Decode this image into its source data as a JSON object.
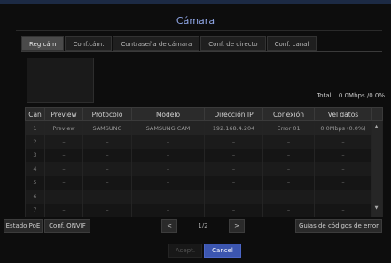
{
  "window": {
    "title": "Cámara"
  },
  "tabs": [
    {
      "label": "Reg cám",
      "active": true
    },
    {
      "label": "Conf.cám."
    },
    {
      "label": "Contraseña de cámara"
    },
    {
      "label": "Conf. de directo"
    },
    {
      "label": "Conf. canal"
    }
  ],
  "total": {
    "label": "Total:",
    "value": "0.0Mbps /0.0%"
  },
  "table": {
    "headers": [
      "Can",
      "Preview",
      "Protocolo",
      "Modelo",
      "Dirección IP",
      "Conexión",
      "Vel datos"
    ],
    "rows": [
      [
        "1",
        "Preview",
        "SAMSUNG",
        "SAMSUNG CAM",
        "192.168.4.204",
        "Error 01",
        "0.0Mbps (0.0%)"
      ],
      [
        "2",
        "–",
        "–",
        "–",
        "–",
        "–",
        "–"
      ],
      [
        "3",
        "–",
        "–",
        "–",
        "–",
        "–",
        "–"
      ],
      [
        "4",
        "–",
        "–",
        "–",
        "–",
        "–",
        "–"
      ],
      [
        "5",
        "–",
        "–",
        "–",
        "–",
        "–",
        "–"
      ],
      [
        "6",
        "–",
        "–",
        "–",
        "–",
        "–",
        "–"
      ],
      [
        "7",
        "–",
        "–",
        "–",
        "–",
        "–",
        "–"
      ]
    ]
  },
  "buttons": {
    "estado_poe": "Estado PoE",
    "conf_onvif": "Conf. ONVIF",
    "prev": "<",
    "page": "1/2",
    "next": ">",
    "guias": "Guías de códigos de error",
    "accept": "Acept.",
    "cancel": "Cancel"
  },
  "icons": {
    "prev": "chevron-left-icon",
    "next": "chevron-right-icon",
    "scroll_up": "triangle-up-icon",
    "scroll_down": "triangle-down-icon"
  },
  "colors": {
    "title": "#8fa6e6",
    "cancel_button": "#3c56b0",
    "background": "#0d0d0d"
  }
}
